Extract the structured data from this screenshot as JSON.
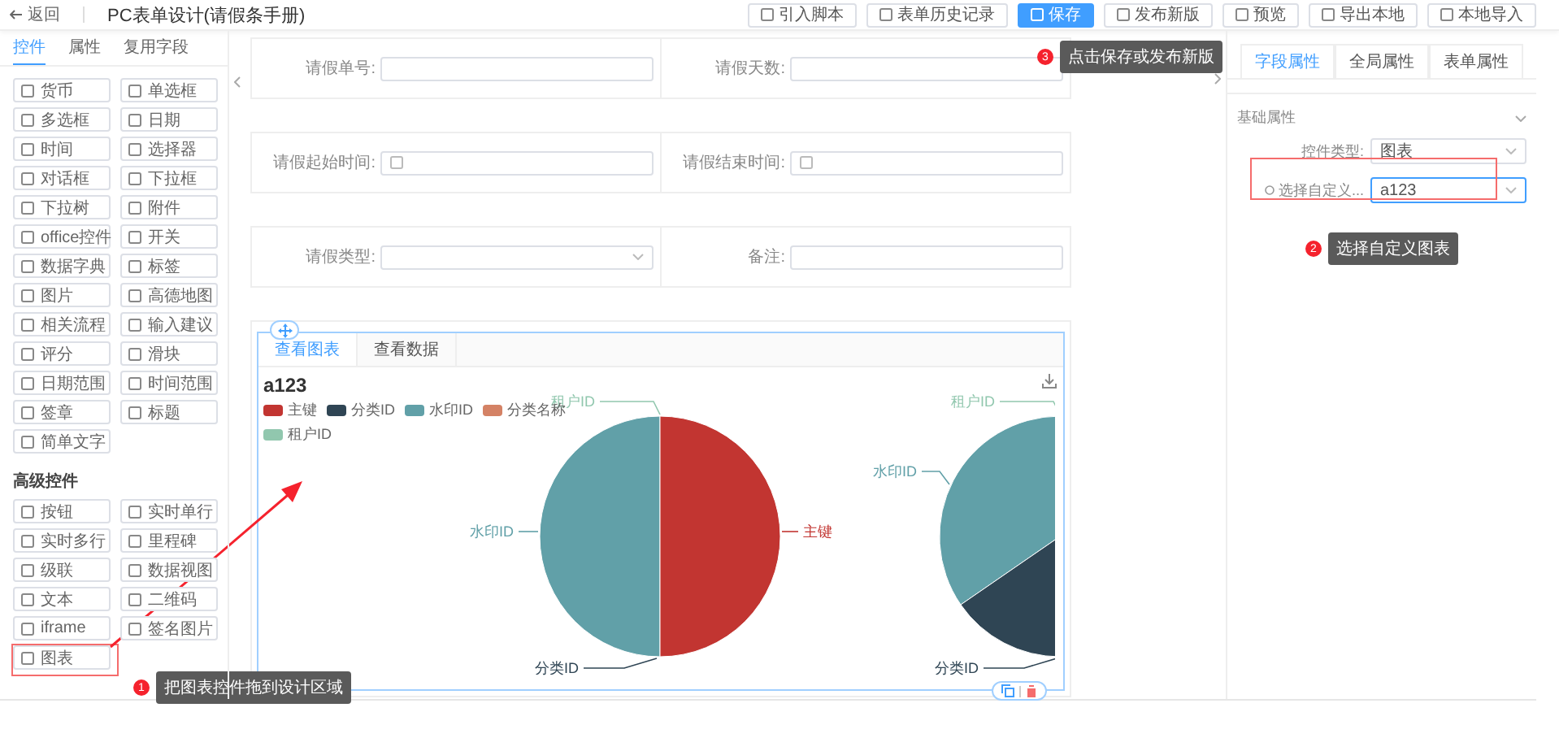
{
  "header": {
    "back": "返回",
    "title": "PC表单设计(请假条手册)"
  },
  "toolbar": [
    {
      "label": "引入脚本",
      "primary": false
    },
    {
      "label": "表单历史记录",
      "primary": false
    },
    {
      "label": "保存",
      "primary": true
    },
    {
      "label": "发布新版",
      "primary": false
    },
    {
      "label": "预览",
      "primary": false
    },
    {
      "label": "导出本地",
      "primary": false
    },
    {
      "label": "本地导入",
      "primary": false
    }
  ],
  "left_panel": {
    "tabs": [
      {
        "label": "控件",
        "selected": true
      },
      {
        "label": "属性",
        "selected": false
      },
      {
        "label": "复用字段",
        "selected": false
      }
    ],
    "basic": [
      "货币",
      "单选框",
      "多选框",
      "日期",
      "时间",
      "选择器",
      "对话框",
      "下拉框",
      "下拉树",
      "附件",
      "office控件",
      "开关",
      "数据字典",
      "标签",
      "图片",
      "高德地图",
      "相关流程",
      "输入建议",
      "评分",
      "滑块",
      "日期范围",
      "时间范围",
      "签章",
      "标题",
      "简单文字"
    ],
    "advanced_heading": "高级控件",
    "advanced": [
      "按钮",
      "实时单行",
      "实时多行",
      "里程碑",
      "级联",
      "数据视图",
      "文本",
      "二维码",
      "iframe",
      "签名图片",
      "图表"
    ]
  },
  "form_rows": [
    [
      {
        "label": "请假单号:",
        "kind": "text"
      },
      {
        "label": "请假天数:",
        "kind": "text"
      }
    ],
    [
      {
        "label": "请假起始时间:",
        "kind": "date"
      },
      {
        "label": "请假结束时间:",
        "kind": "date"
      }
    ],
    [
      {
        "label": "请假类型:",
        "kind": "select"
      },
      {
        "label": "备注:",
        "kind": "text"
      }
    ]
  ],
  "chart_card": {
    "tabs": [
      {
        "label": "查看图表",
        "selected": true
      },
      {
        "label": "查看数据",
        "selected": false
      }
    ],
    "title": "a123",
    "legend": [
      {
        "name": "主键",
        "color": "#c23531"
      },
      {
        "name": "分类ID",
        "color": "#2f4554"
      },
      {
        "name": "水印ID",
        "color": "#61a0a8"
      },
      {
        "name": "分类名称",
        "color": "#d48265"
      },
      {
        "name": "租户ID",
        "color": "#91c7ae"
      }
    ],
    "pies": [
      {
        "labels": [
          {
            "text": "租户ID",
            "color": "#91c7ae"
          },
          {
            "text": "水印ID",
            "color": "#61a0a8"
          },
          {
            "text": "主键",
            "color": "#c23531"
          },
          {
            "text": "分类ID",
            "color": "#2f4554"
          }
        ]
      },
      {
        "labels": [
          {
            "text": "租户ID",
            "color": "#91c7ae"
          },
          {
            "text": "水印ID",
            "color": "#61a0a8"
          },
          {
            "text": "分类ID",
            "color": "#2f4554"
          }
        ]
      }
    ]
  },
  "right_panel": {
    "tabs": [
      {
        "label": "字段属性",
        "selected": true
      },
      {
        "label": "全局属性",
        "selected": false
      },
      {
        "label": "表单属性",
        "selected": false
      }
    ],
    "section": "基础属性",
    "fields": [
      {
        "label": "控件类型:",
        "value": "图表",
        "focused": false
      },
      {
        "label": "选择自定义...",
        "value": "a123",
        "focused": true
      }
    ]
  },
  "callouts": [
    {
      "number": "1",
      "text": "把图表控件拖到设计区域"
    },
    {
      "number": "2",
      "text": "选择自定义图表"
    },
    {
      "number": "3",
      "text": "点击保存或发布新版"
    }
  ]
}
